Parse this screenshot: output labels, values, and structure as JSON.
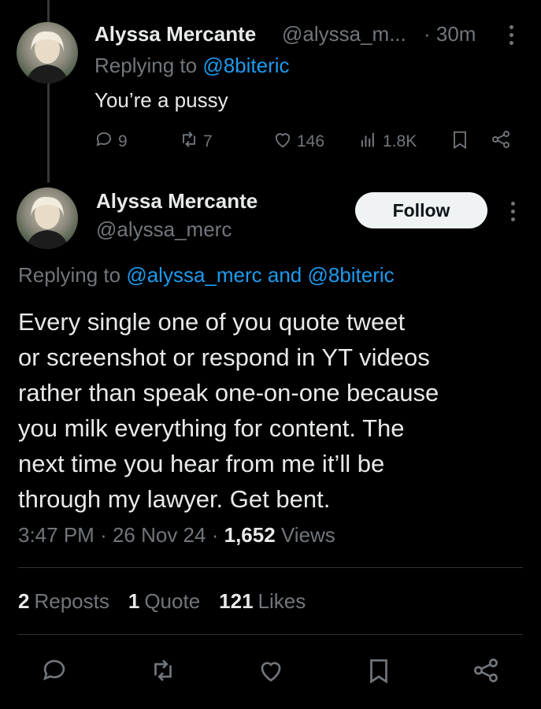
{
  "reply": {
    "name": "Alyssa Mercante",
    "handle": "@alyssa_m...",
    "time": "· 30m",
    "replying_prefix": "Replying to ",
    "replying_to": "@8biteric",
    "text": "You’re a pussy",
    "stats": {
      "replies": "9",
      "reposts": "7",
      "likes": "146",
      "views": "1.8K"
    }
  },
  "main": {
    "name": "Alyssa Mercante",
    "handle": "@alyssa_merc",
    "follow_label": "Follow",
    "replying_prefix": "Replying to ",
    "replying_to": "@alyssa_merc and @8biteric",
    "text_lines": [
      "Every single one of you quote tweet",
      "or screenshot or respond in YT videos",
      "rather than speak one-on-one because",
      "you milk everything for content. The",
      "next time you hear from me it’ll be",
      "through my lawyer. Get bent."
    ],
    "time": "3:47 PM",
    "date": "26 Nov 24",
    "views_count": "1,652",
    "views_label": "Views",
    "reposts_count": "2",
    "reposts_label": "Reposts",
    "quotes_count": "1",
    "quotes_label": "Quote",
    "likes_count": "121",
    "likes_label": "Likes"
  },
  "colors": {
    "background": "#000000",
    "text": "#e7e9ea",
    "muted": "#71767b",
    "link": "#1d9bf0",
    "divider": "#2f3336"
  },
  "icons": [
    "more-icon",
    "reply-icon",
    "repost-icon",
    "like-icon",
    "views-icon",
    "bookmark-icon",
    "share-icon"
  ]
}
